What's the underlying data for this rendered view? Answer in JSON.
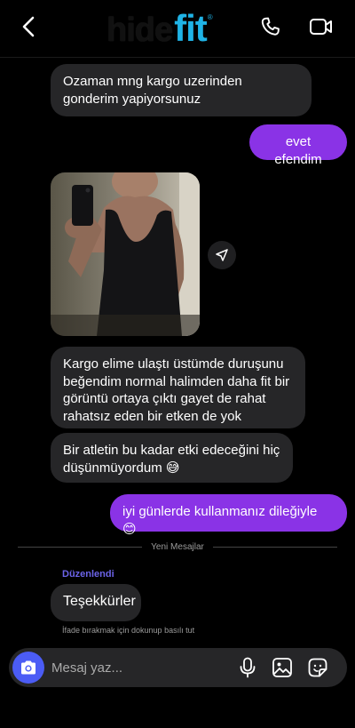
{
  "header": {
    "logo_part1": "hide",
    "logo_part2": "fit",
    "logo_mark": "®",
    "icons": [
      "chevron-left-icon",
      "phone-icon",
      "video-camera-icon"
    ]
  },
  "messages": [
    {
      "dir": "in",
      "text": "Ozaman mng kargo uzerinden gonderim yapiyorsunuz"
    },
    {
      "dir": "out",
      "text": "evet efendim"
    },
    {
      "dir": "in",
      "type": "photo"
    },
    {
      "dir": "in",
      "text": "Kargo elime ulaştı üstümde duruşunu beğendim  normal halimden daha fit bir görüntü ortaya çıktı  gayet de rahat rahatsız eden bir etken de yok"
    },
    {
      "dir": "in",
      "text": "Bir atletin bu kadar etki edeceğini hiç düşünmüyordum 😅"
    },
    {
      "dir": "out",
      "text": "iyi günlerde kullanmanız dileğiyle 😊"
    },
    {
      "dir": "in",
      "text": "Teşekkürler"
    }
  ],
  "divider": {
    "label": "Yeni Mesajlar"
  },
  "edited_label": "Düzenlendi",
  "reaction_hint": "İfade bırakmak için dokunup basılı tut",
  "composer": {
    "placeholder": "Mesaj yaz..."
  },
  "colors": {
    "outgoing": "#8a33e6",
    "incoming": "#262628",
    "accent": "#4b5cf5",
    "edited": "#6b63e8",
    "logo_fit": "#1fb3e6"
  }
}
